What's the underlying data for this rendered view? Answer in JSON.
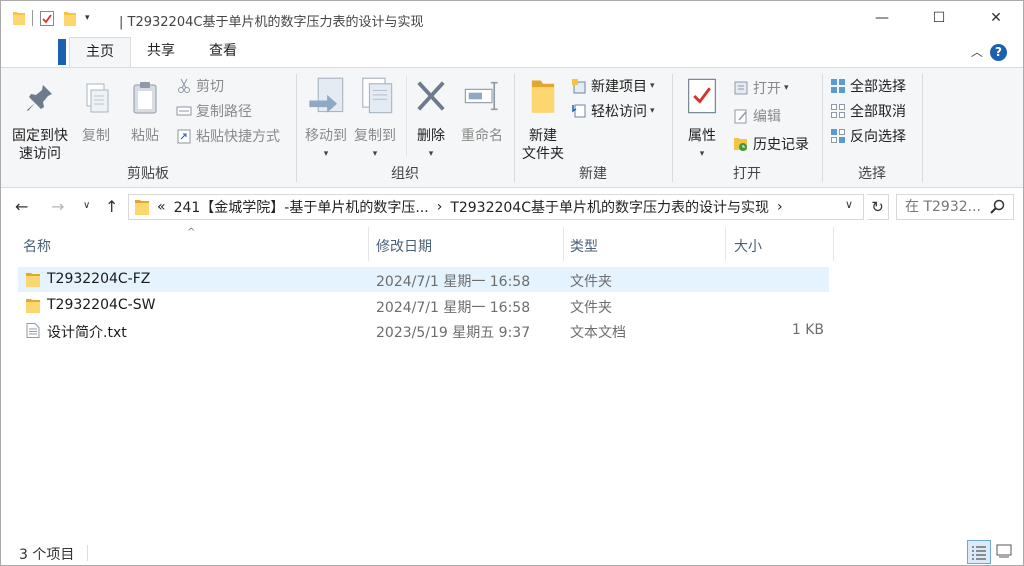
{
  "window": {
    "title": "T2932204C基于单片机的数字压力表的设计与实现",
    "title_prefix": "|",
    "minimize": "—",
    "maximize": "☐",
    "close": "✕"
  },
  "ribbon_tabs": [
    {
      "label": "主页",
      "active": true
    },
    {
      "label": "共享",
      "active": false
    },
    {
      "label": "查看",
      "active": false
    }
  ],
  "ribbon": {
    "clipboard": {
      "label": "剪贴板",
      "pin_line1": "固定到快",
      "pin_line2": "速访问",
      "copy": "复制",
      "paste": "粘贴",
      "cut": "剪切",
      "copy_path": "复制路径",
      "paste_shortcut": "粘贴快捷方式"
    },
    "organize": {
      "label": "组织",
      "move_to": "移动到",
      "copy_to": "复制到",
      "delete": "删除",
      "rename": "重命名"
    },
    "new": {
      "label": "新建",
      "new_folder_line1": "新建",
      "new_folder_line2": "文件夹",
      "new_item": "新建项目",
      "easy_access": "轻松访问"
    },
    "open": {
      "label": "打开",
      "properties": "属性",
      "open": "打开",
      "edit": "编辑",
      "history": "历史记录"
    },
    "select": {
      "label": "选择",
      "select_all": "全部选择",
      "select_none": "全部取消",
      "invert": "反向选择"
    }
  },
  "address": {
    "overflow": "«",
    "crumbs": [
      "241【金城学院】-基于单片机的数字压...",
      "T2932204C基于单片机的数字压力表的设计与实现"
    ],
    "separator": "›",
    "search_placeholder": "在 T2932..."
  },
  "columns": {
    "name": "名称",
    "date": "修改日期",
    "type": "类型",
    "size": "大小"
  },
  "files": [
    {
      "name": "T2932204C-FZ",
      "date": "2024/7/1 星期一 16:58",
      "type": "文件夹",
      "size": "",
      "icon": "folder-icon",
      "selected": true
    },
    {
      "name": "T2932204C-SW",
      "date": "2024/7/1 星期一 16:58",
      "type": "文件夹",
      "size": "",
      "icon": "folder-icon",
      "selected": false
    },
    {
      "name": "设计简介.txt",
      "date": "2023/5/19 星期五 9:37",
      "type": "文本文档",
      "size": "1 KB",
      "icon": "text-file-icon",
      "selected": false
    }
  ],
  "status": {
    "count": "3 个项目"
  },
  "colors": {
    "accent": "#1a62b0",
    "folder": "#f5c542",
    "selected_row": "#e5f3ff",
    "ribbon_bg": "#f5f6f7"
  }
}
